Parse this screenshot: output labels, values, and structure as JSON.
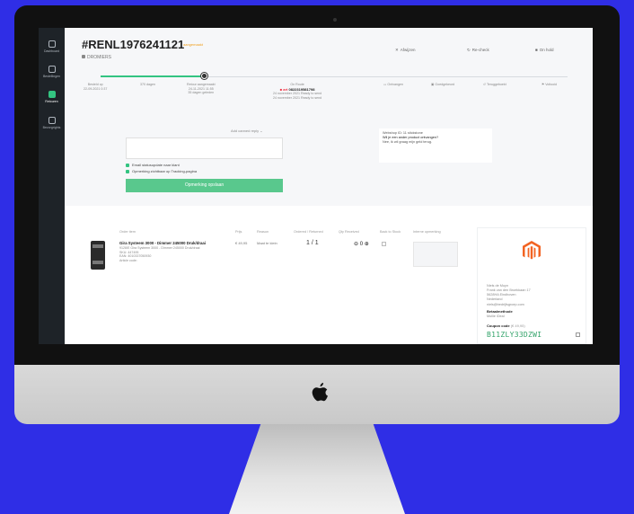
{
  "sidebar": {
    "items": [
      {
        "label": "Dashboard",
        "icon": "home-icon"
      },
      {
        "label": "Bestellingen",
        "icon": "orders-icon"
      },
      {
        "label": "Retouren",
        "icon": "returns-icon"
      },
      {
        "label": "Bezorgrights",
        "icon": "rights-icon"
      }
    ]
  },
  "order": {
    "number": "#RENL1976241121",
    "status": "aangemaakt",
    "dealer": "DROMIERS"
  },
  "actions": {
    "afwijzen": "Afwijzen",
    "recheck": "Re-check",
    "onhold": "On hold"
  },
  "timeline": {
    "besteldop": {
      "title": "Besteld op",
      "sub": "22-09-2021 0:37"
    },
    "days": {
      "title": "370 dagen"
    },
    "retour": {
      "title": "Retour aangemaakt",
      "sub1": "24-11-2021 11:55",
      "sub2": "35 dagen geleden"
    },
    "onroute": {
      "title": "On Route",
      "code_prefix": "■ art",
      "code": "0822319581798",
      "line1": "24 november 2021 Ready to send",
      "line2": "24 november 2021 Ready to send"
    },
    "steps": [
      {
        "label": "Ontvangen"
      },
      {
        "label": "Goedgekeurd"
      },
      {
        "label": "Teruggeboekt"
      },
      {
        "label": "Voltooid"
      }
    ]
  },
  "notes": {
    "select": "Add canned reply",
    "email_check": "Email statusupdate naar klant",
    "tracking_check": "Opmerking zichtbaar op Tracking-pagina",
    "save": "Opmerking opslaan"
  },
  "message": {
    "line1": "Webshop ID: 11 stickstone",
    "line2": "Wil je een ander product ontvangen?",
    "line3": "Nee, ik wil graag mijn geld terug."
  },
  "table": {
    "headers": [
      "Order item",
      "Prijs",
      "Reason",
      "Ordered / Returned",
      "Qty Received",
      "Back to Stock",
      "Interne opmerking"
    ],
    "row": {
      "name": "Gira Systeem 3000 - Dimmer 245000 Druk/draai",
      "desc": "9128/E Gira Systeem 3000 - Dimmer 245000 Druk/draai",
      "sku": "SKU: 447495",
      "ean": "EAN: 4010337050930",
      "article": "Article code:",
      "price": "€ 49,95",
      "reason": "Maat te klein",
      "qty": "1 / 1",
      "received": "0"
    }
  },
  "customer": {
    "name": "Niels de Muyn",
    "street": "Frank van den Broekkaan 17",
    "zip": "5628HA Eindhoven",
    "country": "Nederland",
    "email": "niels@bedrijfsgroep.com",
    "payment_label": "Betaalmethode",
    "payment_value": "Mollie iDeal",
    "coupon_label": "Coupon code",
    "coupon_amount": "(€ 49,95)",
    "coupon_code": "B11ZLY33DZWI"
  },
  "colors": {
    "accent": "#33c481",
    "brand": "#f26322",
    "background": "#2f2ee6"
  }
}
